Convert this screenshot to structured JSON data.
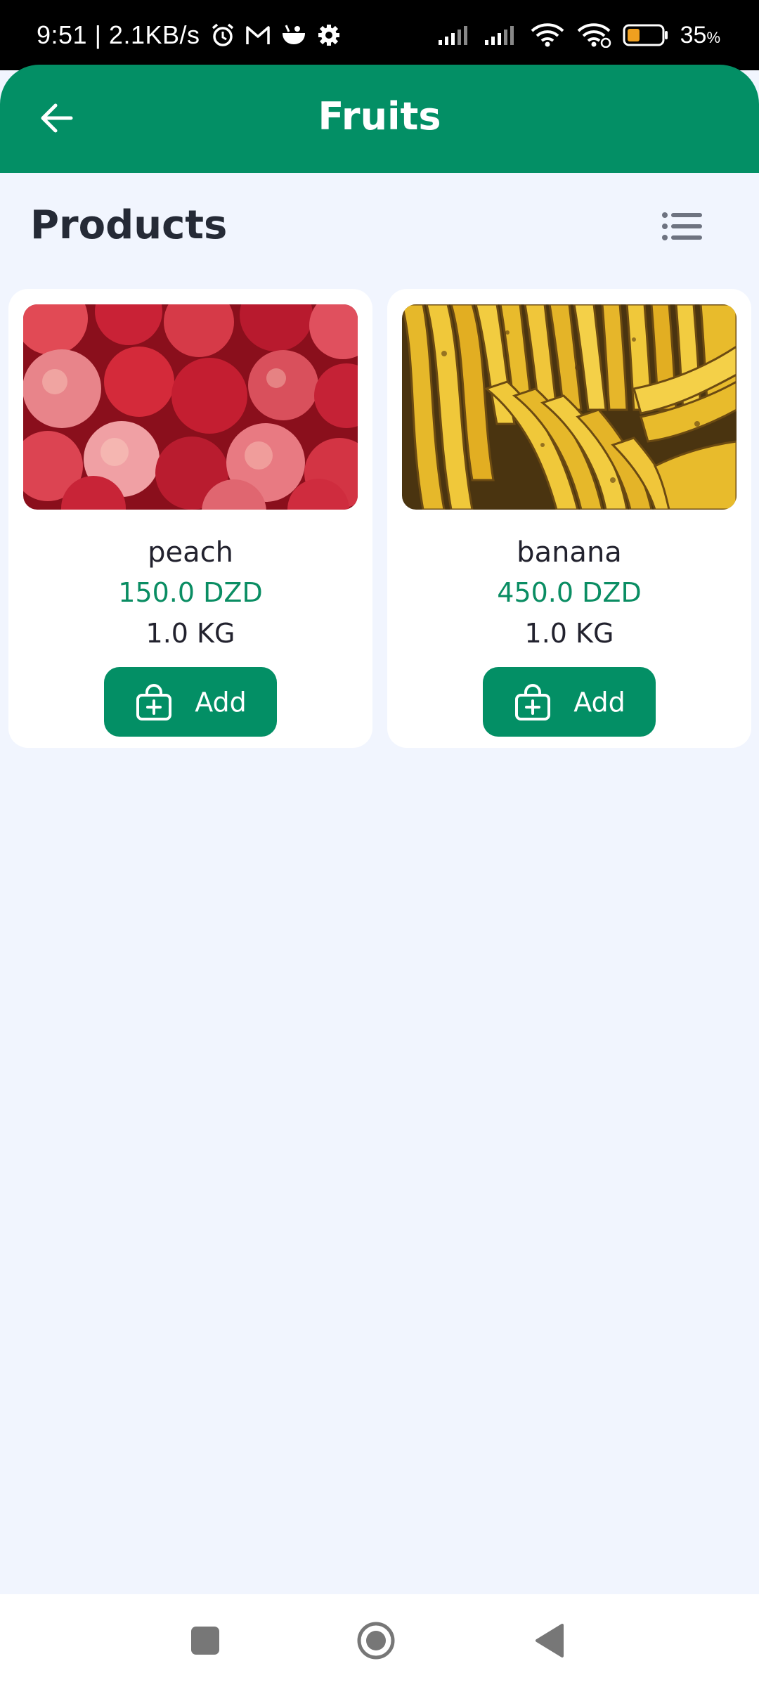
{
  "status_bar": {
    "time_and_speed": "9:51 | 2.1KB/s",
    "battery_percent": "35",
    "battery_suffix": "%",
    "icons": [
      "alarm-icon",
      "gmail-icon",
      "bowl-icon",
      "settings-icon",
      "signal-icon",
      "signal-icon",
      "wifi-icon",
      "wifi-link-icon",
      "battery-icon"
    ]
  },
  "app_bar": {
    "title": "Fruits",
    "back_icon": "arrow-left-icon"
  },
  "section": {
    "title": "Products",
    "view_toggle_icon": "list-view-icon"
  },
  "products": [
    {
      "name": "peach",
      "price": "150.0 DZD",
      "weight": "1.0 KG",
      "add_label": "Add",
      "image": "peaches-photo"
    },
    {
      "name": "banana",
      "price": "450.0 DZD",
      "weight": "1.0 KG",
      "add_label": "Add",
      "image": "bananas-photo"
    }
  ],
  "nav_bar": {
    "icons": [
      "recent-apps-icon",
      "home-icon",
      "back-icon"
    ]
  },
  "colors": {
    "primary": "#038f65",
    "price": "#0a8d63",
    "background": "#f1f5fe"
  }
}
